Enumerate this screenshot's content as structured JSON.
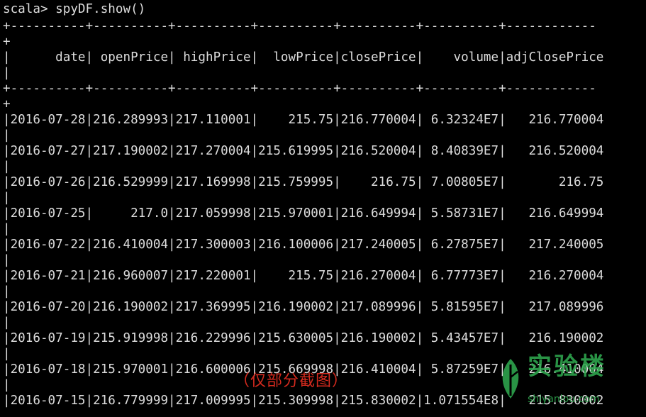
{
  "terminal": {
    "prompt": "scala>",
    "command": "spyDF.show()"
  },
  "table": {
    "border_line": "+----------+----------+----------+----------+----------+----------+------------",
    "border_wrap": "+",
    "header_line": "|      date| openPrice| highPrice|  lowPrice|closePrice|    volume|adjClosePrice",
    "wrap_char": "|",
    "rows": [
      "|2016-07-28|216.289993|217.110001|    215.75|216.770004| 6.32324E7|   216.770004",
      "|2016-07-27|217.190002|217.270004|215.619995|216.520004| 8.40839E7|   216.520004",
      "|2016-07-26|216.529999|217.169998|215.759995|    216.75| 7.00805E7|       216.75",
      "|2016-07-25|     217.0|217.059998|215.970001|216.649994| 5.58731E7|   216.649994",
      "|2016-07-22|216.410004|217.300003|216.100006|217.240005| 6.27875E7|   217.240005",
      "|2016-07-21|216.960007|217.220001|    215.75|216.270004| 6.77773E7|   216.270004",
      "|2016-07-20|216.190002|217.369995|216.190002|217.089996| 5.81595E7|   217.089996",
      "|2016-07-19|215.919998|216.229996|215.630005|216.190002| 5.43457E7|   216.190002",
      "|2016-07-18|215.970001|216.600006|215.669998|216.410004| 5.87259E7|   216.410004",
      "|2016-07-15|216.779999|217.009995|215.309998|215.830002|1.071554E8|   215.830002"
    ]
  },
  "overlay": {
    "caption": "（仅部分截图）",
    "logo_text": "实验楼",
    "logo_sub": "shiyanlou.com",
    "logo_color": "#2fa84f",
    "caption_color": "#d42a1e"
  }
}
